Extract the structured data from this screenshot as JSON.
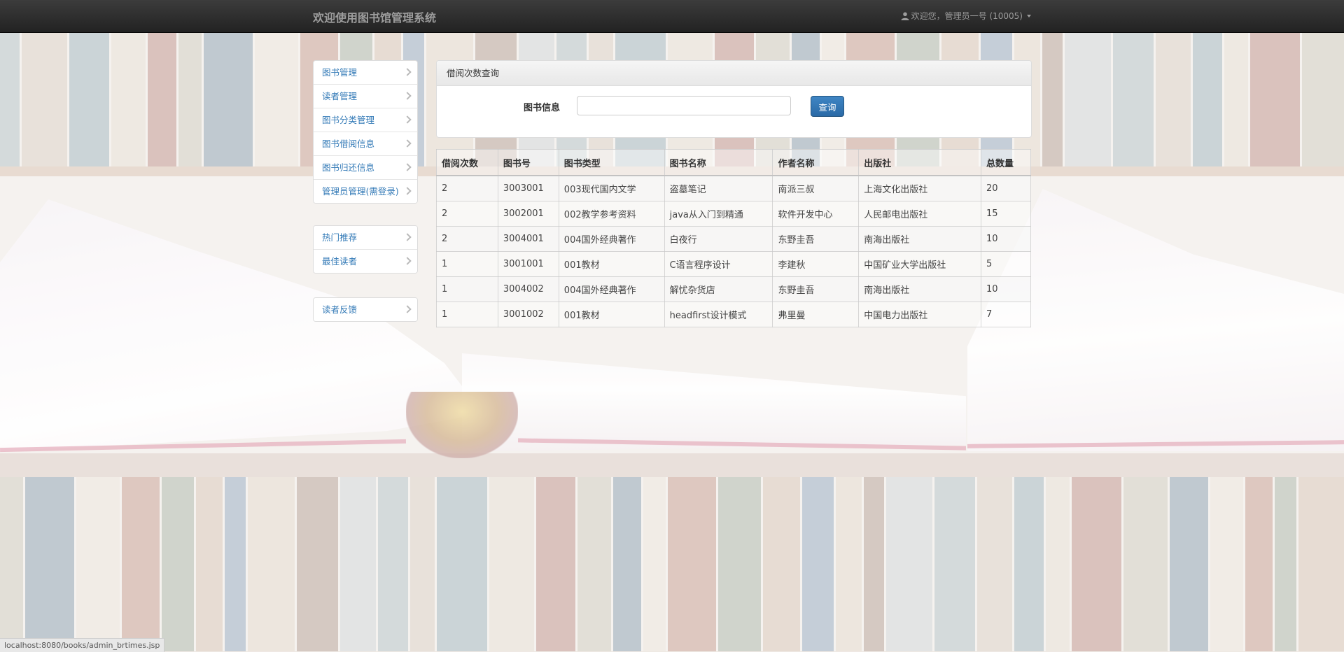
{
  "navbar": {
    "brand": "欢迎使用图书馆管理系统",
    "user_menu": "欢迎您，管理员一号 (10005)"
  },
  "sidebar": {
    "groups": [
      [
        {
          "label": "图书管理"
        },
        {
          "label": "读者管理"
        },
        {
          "label": "图书分类管理"
        },
        {
          "label": "图书借阅信息"
        },
        {
          "label": "图书归还信息"
        },
        {
          "label": "管理员管理(需登录)"
        }
      ],
      [
        {
          "label": "热门推荐"
        },
        {
          "label": "最佳读者"
        }
      ],
      [
        {
          "label": "读者反馈"
        }
      ]
    ]
  },
  "query_panel": {
    "heading": "借阅次数查询",
    "label": "图书信息",
    "input_value": "",
    "button": "查询"
  },
  "table": {
    "headers": [
      "借阅次数",
      "图书号",
      "图书类型",
      "图书名称",
      "作者名称",
      "出版社",
      "总数量"
    ],
    "rows": [
      [
        "2",
        "3003001",
        "003现代国内文学",
        "盗墓笔记",
        "南派三叔",
        "上海文化出版社",
        "20"
      ],
      [
        "2",
        "3002001",
        "002教学参考资料",
        "java从入门到精通",
        "软件开发中心",
        "人民邮电出版社",
        "15"
      ],
      [
        "2",
        "3004001",
        "004国外经典著作",
        "白夜行",
        "东野圭吾",
        "南海出版社",
        "10"
      ],
      [
        "1",
        "3001001",
        "001教材",
        "C语言程序设计",
        "李建秋",
        "中国矿业大学出版社",
        "5"
      ],
      [
        "1",
        "3004002",
        "004国外经典著作",
        "解忧杂货店",
        "东野圭吾",
        "南海出版社",
        "10"
      ],
      [
        "1",
        "3001002",
        "001教材",
        "headfirst设计模式",
        "弗里曼",
        "中国电力出版社",
        "7"
      ]
    ]
  },
  "status_bar": "localhost:8080/books/admin_brtimes.jsp",
  "colors": {
    "navbar_bg": "#222222",
    "link": "#337ab7",
    "primary_button": "#2a6aa6"
  },
  "icons": {
    "user": "user-icon",
    "chevron": "chevron-right-icon",
    "caret": "caret-down-icon"
  }
}
